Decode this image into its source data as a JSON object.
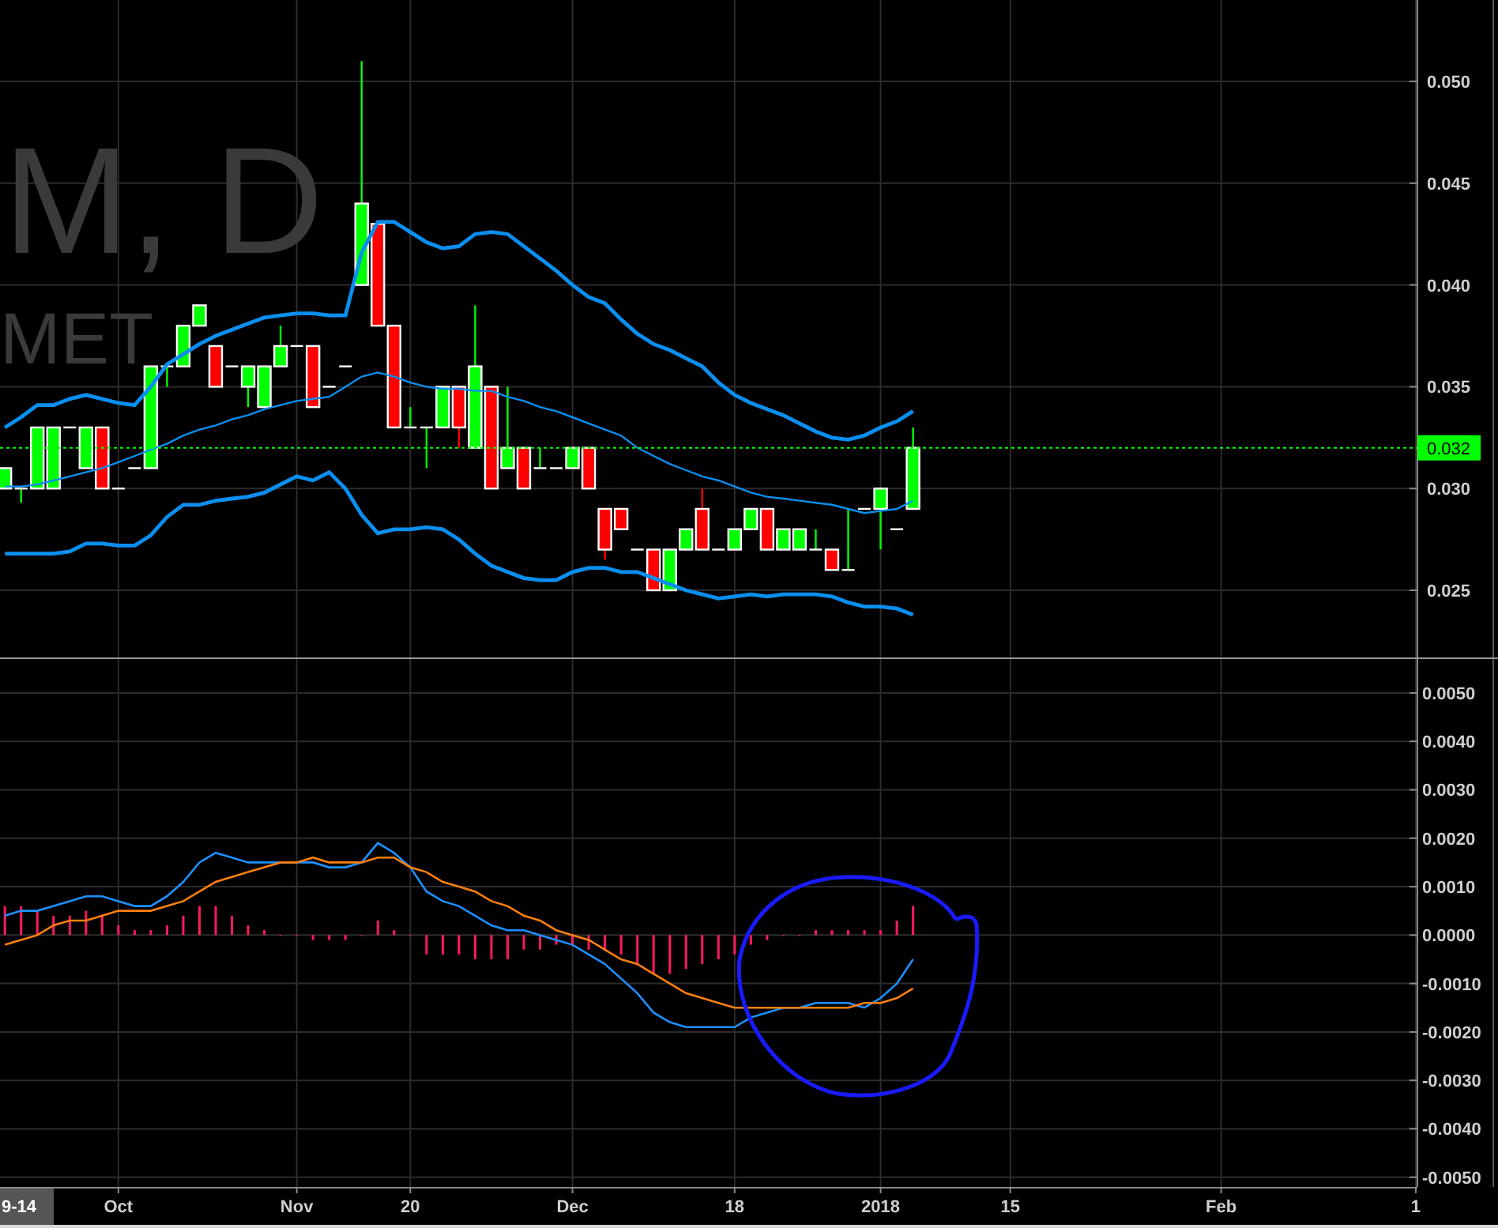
{
  "price_panel": {
    "symbol_watermark": [
      "M, D",
      "MET"
    ],
    "chart_data": {
      "type": "line",
      "grid": true,
      "categories": [
        null,
        null,
        null,
        null,
        null,
        null,
        null,
        null,
        null,
        null,
        null,
        null,
        null,
        null,
        null,
        null,
        null,
        null,
        null,
        null,
        null,
        null,
        null,
        null,
        null,
        null,
        null,
        null,
        null,
        null,
        null,
        null,
        null,
        null,
        null,
        null,
        null,
        null,
        null,
        null,
        null,
        null,
        null,
        null,
        null,
        null,
        null,
        null,
        null,
        null,
        null,
        null,
        null,
        null,
        null,
        null,
        null,
        null,
        null,
        null,
        null,
        null,
        null,
        null,
        null,
        null,
        null,
        null,
        null,
        null,
        null,
        null,
        null,
        null,
        null,
        null,
        null,
        null,
        null,
        null,
        null,
        null,
        null,
        null,
        null,
        null,
        null,
        null
      ],
      "ylim": [
        0.0217,
        0.054
      ],
      "yticks": [
        {
          "value": 0.025,
          "label": "0.025"
        },
        {
          "value": 0.03,
          "label": "0.030"
        },
        {
          "value": 0.035,
          "label": "0.035"
        },
        {
          "value": 0.04,
          "label": "0.040"
        },
        {
          "value": 0.045,
          "label": "0.045"
        },
        {
          "value": 0.05,
          "label": "0.050"
        }
      ],
      "ref_lines": [
        {
          "axis": "y",
          "value": 0.032,
          "label": "0.032",
          "color": "#00ff00"
        }
      ],
      "series": [
        {
          "color": "#0a8ff0",
          "values": [
            0.033,
            0.0335,
            0.0341,
            0.0341,
            0.0344,
            0.0346,
            0.0344,
            0.0342,
            0.0341,
            0.035,
            0.0361,
            0.0366,
            0.0371,
            0.0375,
            0.0378,
            0.0381,
            0.0384,
            0.0385,
            0.0386,
            0.0386,
            0.0385,
            0.0385,
            0.0416,
            0.0431,
            0.0431,
            0.0426,
            0.0421,
            0.0418,
            0.0419,
            0.0425,
            0.0426,
            0.0425,
            0.0419,
            0.0413,
            0.0407,
            0.04,
            0.0394,
            0.0391,
            0.0383,
            0.0376,
            0.0371,
            0.0368,
            0.0364,
            0.036,
            0.0352,
            0.0346,
            0.0342,
            0.0339,
            0.0336,
            0.0332,
            0.0328,
            0.0325,
            0.0324,
            0.0326,
            0.033,
            0.0333,
            0.0338,
            null,
            null,
            null,
            null,
            null,
            null,
            null,
            null,
            null,
            null,
            null,
            null,
            null,
            null,
            null,
            null,
            null,
            null,
            null,
            null,
            null,
            null,
            null,
            null,
            null,
            null,
            null,
            null,
            null,
            null,
            null
          ]
        },
        {
          "color": "#0a8ff0",
          "values": [
            0.0301,
            0.0301,
            0.0302,
            0.0304,
            0.0306,
            0.0308,
            0.031,
            0.0313,
            0.0316,
            0.0319,
            0.0322,
            0.0326,
            0.0329,
            0.0331,
            0.0334,
            0.0336,
            0.0339,
            0.0341,
            0.0343,
            0.0344,
            0.0345,
            0.035,
            0.0355,
            0.0357,
            0.0355,
            0.0352,
            0.035,
            0.0349,
            0.0349,
            0.0348,
            0.0348,
            0.0345,
            0.0343,
            0.034,
            0.0338,
            0.0335,
            0.0332,
            0.0329,
            0.0326,
            0.032,
            0.0316,
            0.0312,
            0.0309,
            0.0306,
            0.0304,
            0.0301,
            0.0298,
            0.0296,
            0.0295,
            0.0294,
            0.0293,
            0.0292,
            0.029,
            0.0288,
            0.0289,
            0.029,
            0.0294,
            null,
            null,
            null,
            null,
            null,
            null,
            null,
            null,
            null,
            null,
            null,
            null,
            null,
            null,
            null,
            null,
            null,
            null,
            null,
            null,
            null,
            null,
            null,
            null,
            null,
            null,
            null,
            null,
            null,
            null,
            null
          ]
        },
        {
          "color": "#0a8ff0",
          "values": [
            0.0268,
            0.0268,
            0.0268,
            0.0268,
            0.0269,
            0.0273,
            0.0273,
            0.0272,
            0.0272,
            0.0277,
            0.0286,
            0.0292,
            0.0292,
            0.0294,
            0.0295,
            0.0296,
            0.0298,
            0.0302,
            0.0306,
            0.0304,
            0.0308,
            0.03,
            0.0287,
            0.0278,
            0.028,
            0.028,
            0.0281,
            0.028,
            0.0275,
            0.0268,
            0.0262,
            0.0259,
            0.0256,
            0.0255,
            0.0255,
            0.0259,
            0.0261,
            0.0261,
            0.0259,
            0.0259,
            0.0256,
            0.0253,
            0.025,
            0.0248,
            0.0246,
            0.0247,
            0.0248,
            0.0247,
            0.0248,
            0.0248,
            0.0248,
            0.0247,
            0.0244,
            0.0242,
            0.0242,
            0.0241,
            0.0238,
            null,
            null,
            null,
            null,
            null,
            null,
            null,
            null,
            null,
            null,
            null,
            null,
            null,
            null,
            null,
            null,
            null,
            null,
            null,
            null,
            null,
            null,
            null,
            null,
            null,
            null,
            null,
            null,
            null,
            null,
            null
          ]
        }
      ]
    }
  },
  "macd_panel": {
    "chart_data": {
      "type": "line",
      "grid": true,
      "categories": [
        null,
        null,
        null,
        null,
        null,
        null,
        null,
        "Oct",
        null,
        null,
        null,
        null,
        null,
        null,
        null,
        null,
        null,
        null,
        "Nov",
        null,
        null,
        null,
        null,
        null,
        null,
        "20",
        null,
        null,
        null,
        null,
        null,
        null,
        null,
        null,
        null,
        "Dec",
        null,
        null,
        null,
        null,
        null,
        null,
        null,
        null,
        null,
        "18",
        null,
        null,
        null,
        null,
        null,
        null,
        null,
        null,
        "2018",
        null,
        null,
        null,
        null,
        null,
        null,
        null,
        "15",
        null,
        null,
        null,
        null,
        null,
        null,
        null,
        null,
        null,
        null,
        null,
        null,
        "Feb",
        null,
        null,
        null,
        null,
        null,
        null,
        null,
        null,
        null,
        null,
        null,
        "1"
      ],
      "ylim": [
        -0.0052,
        0.0057
      ],
      "yticks": [
        {
          "value": 0.005,
          "label": "0.0050"
        },
        {
          "value": 0.004,
          "label": "0.0040"
        },
        {
          "value": 0.003,
          "label": "0.0030"
        },
        {
          "value": 0.002,
          "label": "0.0020"
        },
        {
          "value": 0.001,
          "label": "0.0010"
        },
        {
          "value": 0,
          "label": "0.0000"
        },
        {
          "value": -0.001,
          "label": "-0.0010"
        },
        {
          "value": -0.002,
          "label": "-0.0020"
        },
        {
          "value": -0.003,
          "label": "-0.0030"
        },
        {
          "value": -0.004,
          "label": "-0.0040"
        },
        {
          "value": -0.005,
          "label": "-0.0050"
        }
      ],
      "series": [
        {
          "type": "bar",
          "color": "#ff1a5e",
          "values": [
            0.0006,
            0.0006,
            0.0005,
            0.0004,
            0.0004,
            0.0005,
            0.0004,
            0.0002,
            0.0001,
            0.0001,
            0.0002,
            0.0004,
            0.0006,
            0.0006,
            0.0004,
            0.0002,
            0.0001,
            0,
            0,
            -0.0001,
            -0.0001,
            -0.0001,
            0,
            0.0003,
            0.0001,
            0,
            -0.0004,
            -0.0004,
            -0.0004,
            -0.0005,
            -0.0005,
            -0.0005,
            -0.0003,
            -0.0003,
            -0.0002,
            -0.0002,
            -0.0003,
            -0.0003,
            -0.0004,
            -0.0006,
            -0.0008,
            -0.0008,
            -0.0007,
            -0.0006,
            -0.0005,
            -0.0004,
            -0.0002,
            -0.0001,
            0,
            0,
            0.0001,
            0.0001,
            0.0001,
            0.0001,
            0.0001,
            0.0003,
            0.0006,
            null,
            null,
            null,
            null,
            null,
            null,
            null,
            null,
            null,
            null,
            null,
            null,
            null,
            null,
            null,
            null,
            null,
            null,
            null,
            null,
            null,
            null,
            null,
            null,
            null,
            null,
            null,
            null,
            null,
            null,
            null
          ]
        },
        {
          "color": "#1e90ff",
          "values": [
            0.0004,
            0.0005,
            0.0005,
            0.0006,
            0.0007,
            0.0008,
            0.0008,
            0.0007,
            0.0006,
            0.0006,
            0.0008,
            0.0011,
            0.0015,
            0.0017,
            0.0016,
            0.0015,
            0.0015,
            0.0015,
            0.0015,
            0.0015,
            0.0014,
            0.0014,
            0.0015,
            0.0019,
            0.0017,
            0.0014,
            0.0009,
            0.0007,
            0.0006,
            0.0004,
            0.0002,
            0.0001,
            0.0001,
            0.0,
            -0.0001,
            -0.0002,
            -0.0004,
            -0.0006,
            -0.0009,
            -0.0012,
            -0.0016,
            -0.0018,
            -0.0019,
            -0.0019,
            -0.0019,
            -0.0019,
            -0.0017,
            -0.0016,
            -0.0015,
            -0.0015,
            -0.0014,
            -0.0014,
            -0.0014,
            -0.0015,
            -0.0013,
            -0.001,
            -0.0005,
            null,
            null,
            null,
            null,
            null,
            null,
            null,
            null,
            null,
            null,
            null,
            null,
            null,
            null,
            null,
            null,
            null,
            null,
            null,
            null,
            null,
            null,
            null,
            null,
            null,
            null,
            null,
            null,
            null,
            null,
            null
          ]
        },
        {
          "color": "#ff7f0e",
          "values": [
            -0.0002,
            -0.0001,
            0,
            0.0002,
            0.0003,
            0.0003,
            0.0004,
            0.0005,
            0.0005,
            0.0005,
            0.0006,
            0.0007,
            0.0009,
            0.0011,
            0.0012,
            0.0013,
            0.0014,
            0.0015,
            0.0015,
            0.0016,
            0.0015,
            0.0015,
            0.0015,
            0.0016,
            0.0016,
            0.0014,
            0.0013,
            0.0011,
            0.001,
            0.0009,
            0.0007,
            0.0006,
            0.0004,
            0.0003,
            0.0001,
            0,
            -0.0001,
            -0.0003,
            -0.0005,
            -0.0006,
            -0.0008,
            -0.001,
            -0.0012,
            -0.0013,
            -0.0014,
            -0.0015,
            -0.0015,
            -0.0015,
            -0.0015,
            -0.0015,
            -0.0015,
            -0.0015,
            -0.0015,
            -0.0014,
            -0.0014,
            -0.0013,
            -0.0011,
            null,
            null,
            null,
            null,
            null,
            null,
            null,
            null,
            null,
            null,
            null,
            null,
            null,
            null,
            null,
            null,
            null,
            null,
            null,
            null,
            null,
            null,
            null,
            null,
            null,
            null,
            null,
            null,
            null,
            null,
            null
          ]
        }
      ]
    }
  },
  "x_axis": {
    "cursor_label": "9-14"
  }
}
